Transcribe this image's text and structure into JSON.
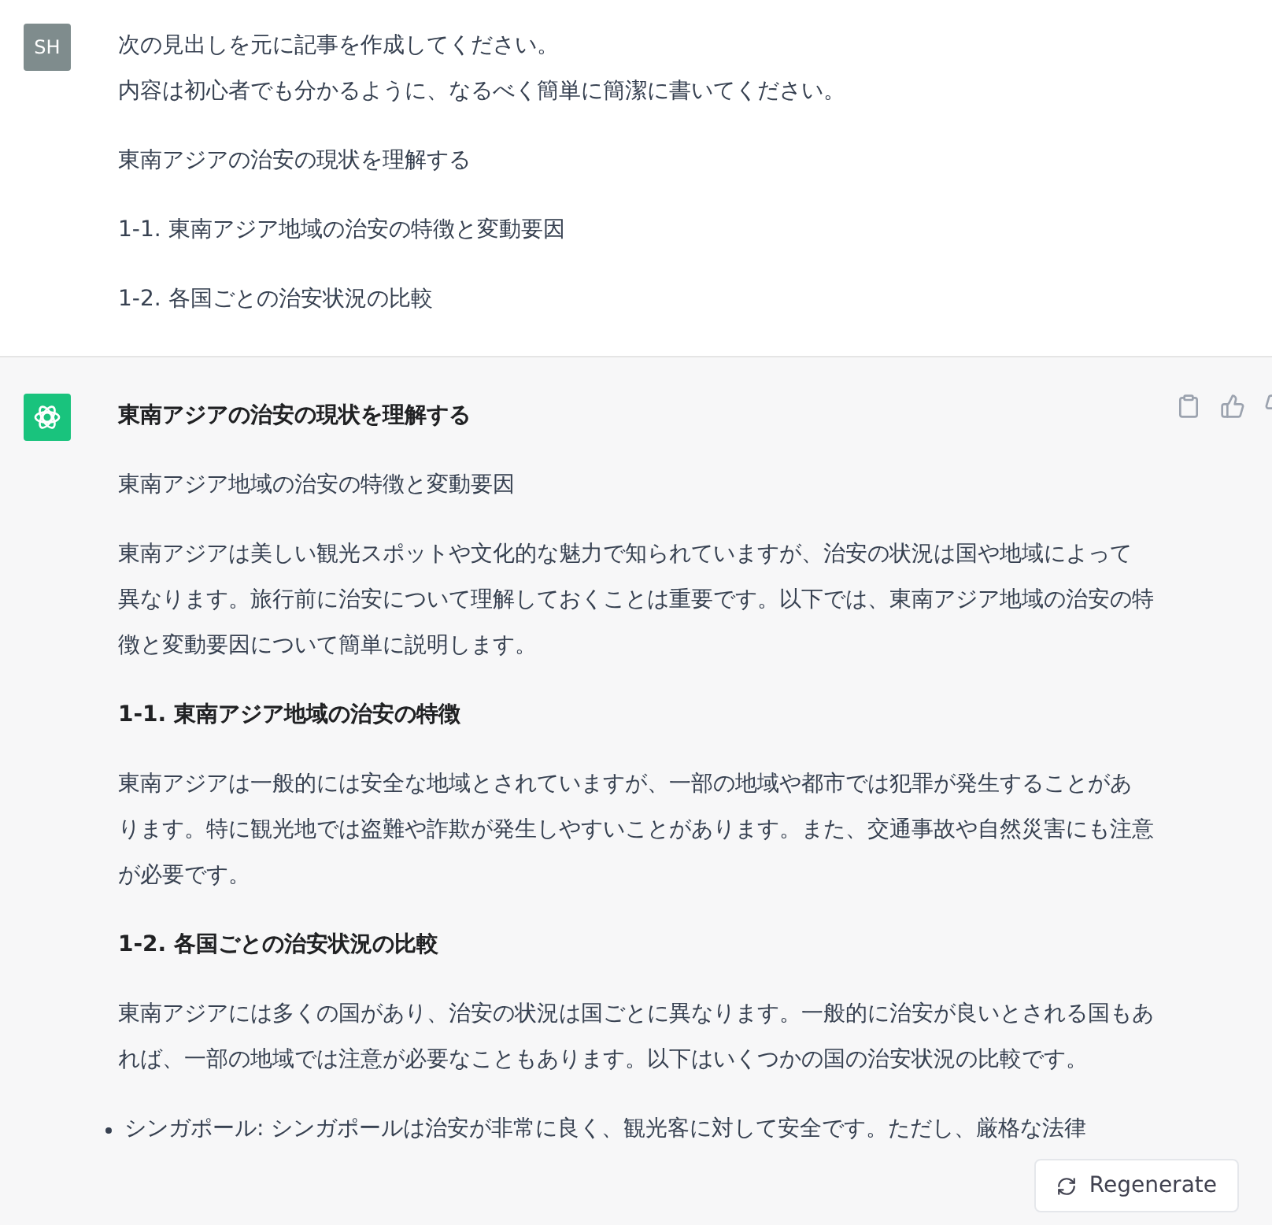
{
  "messages": [
    {
      "kind": "user",
      "avatar": "SH",
      "blocks": [
        {
          "kind": "text",
          "lines": [
            "次の見出しを元に記事を作成してください。",
            "内容は初心者でも分かるように、なるべく簡単に簡潔に書いてください。"
          ]
        },
        {
          "kind": "text",
          "lines": [
            "東南アジアの治安の現状を理解する"
          ]
        },
        {
          "kind": "text",
          "lines": [
            "1-1. 東南アジア地域の治安の特徴と変動要因"
          ]
        },
        {
          "kind": "text",
          "lines": [
            "1-2. 各国ごとの治安状況の比較"
          ]
        }
      ]
    },
    {
      "kind": "assistant",
      "blocks": [
        {
          "kind": "heading",
          "text": "東南アジアの治安の現状を理解する"
        },
        {
          "kind": "text",
          "lines": [
            "東南アジア地域の治安の特徴と変動要因"
          ]
        },
        {
          "kind": "text",
          "lines": [
            "東南アジアは美しい観光スポットや文化的な魅力で知られていますが、治安の状況は国や地域によって",
            "異なります。旅行前に治安について理解しておくことは重要です。以下では、東南アジア地域の治安の特",
            "徴と変動要因について簡単に説明します。"
          ]
        },
        {
          "kind": "heading",
          "text": "1-1. 東南アジア地域の治安の特徴"
        },
        {
          "kind": "text",
          "lines": [
            "東南アジアは一般的には安全な地域とされていますが、一部の地域や都市では犯罪が発生することがあ",
            "ります。特に観光地では盗難や詐欺が発生しやすいことがあります。また、交通事故や自然災害にも注意",
            "が必要です。"
          ]
        },
        {
          "kind": "heading",
          "text": "1-2. 各国ごとの治安状況の比較"
        },
        {
          "kind": "text",
          "lines": [
            "東南アジアには多くの国があり、治安の状況は国ごとに異なります。一般的に治安が良いとされる国もあ",
            "れば、一部の地域では注意が必要なこともあります。以下はいくつかの国の治安状況の比較です。"
          ]
        },
        {
          "kind": "bullet",
          "text": "シンガポール: シンガポールは治安が非常に良く、観光客に対して安全です。ただし、厳格な法律"
        }
      ]
    }
  ],
  "regenerate_button": {
    "label": "Regenerate"
  }
}
